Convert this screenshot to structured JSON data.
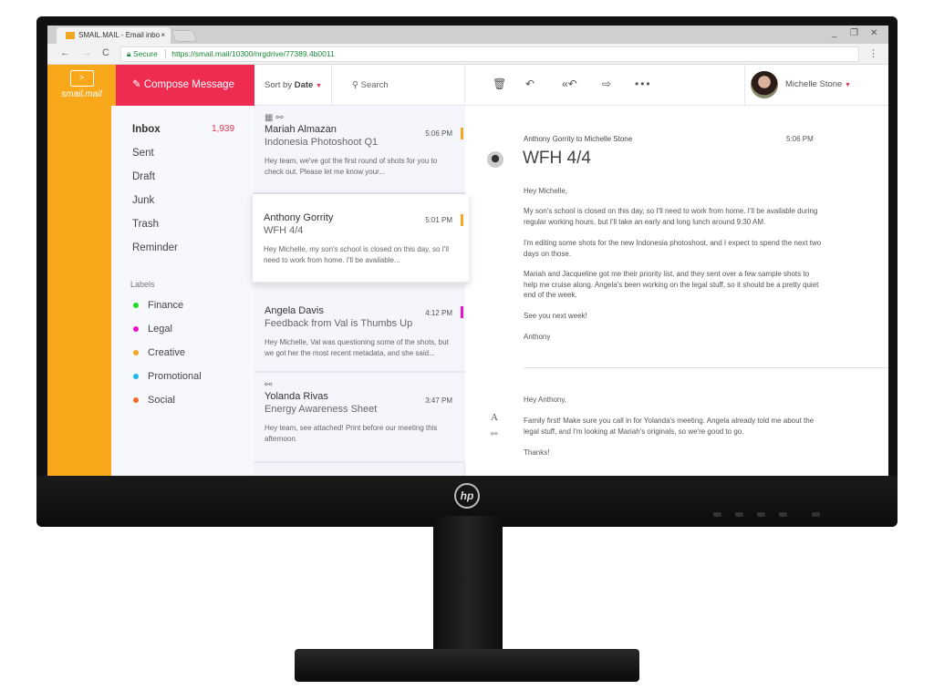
{
  "browser": {
    "tab_title": "SMAIL.MAIL - Email inbo",
    "tab_close": "×",
    "url_secure": "Secure",
    "url": "https://smail.mail/10300/nrgdrive/77389.4b0011",
    "back": "←",
    "forward": "→",
    "reload": "C",
    "menu": "⋮",
    "minimize": "_",
    "restore": "❐",
    "close": "✕"
  },
  "app": {
    "logo_text": "smail.mail",
    "logo_icon": "envelope-icon",
    "compose_label": "Compose Message",
    "compose_icon": "compose-icon",
    "brand_color": "#f9a81b",
    "accent_color": "#ee2c52"
  },
  "nav": {
    "folders": [
      {
        "label": "Inbox",
        "count": "1,939"
      },
      {
        "label": "Sent"
      },
      {
        "label": "Draft"
      },
      {
        "label": "Junk"
      },
      {
        "label": "Trash"
      },
      {
        "label": "Reminder"
      }
    ],
    "labels_heading": "Labels",
    "labels": [
      {
        "label": "Finance",
        "color": "#22dd22"
      },
      {
        "label": "Legal",
        "color": "#ee11cc"
      },
      {
        "label": "Creative",
        "color": "#f5a623"
      },
      {
        "label": "Promotional",
        "color": "#1cb8e8"
      },
      {
        "label": "Social",
        "color": "#f06a2a"
      }
    ]
  },
  "list_header": {
    "sort_prefix": "Sort by",
    "sort_value": "Date",
    "search_placeholder": "Search"
  },
  "mails": [
    {
      "icons": "calendar-icon link-icon",
      "from": "Mariah Almazan",
      "time": "5:06 PM",
      "subject": "Indonesia Photoshoot Q1",
      "preview": "Hey team, we've got the first round of shots for you to check out. Please let me know your...",
      "label_color": "#f5a623"
    },
    {
      "from": "Anthony Gorrity",
      "time": "5:01 PM",
      "subject": "WFH 4/4",
      "preview": "Hey Michelle, my son's school is closed on this day, so I'll need to work from home. I'll be available...",
      "label_color": "#f5a623",
      "selected": true
    },
    {
      "from": "Angela Davis",
      "time": "4:12 PM",
      "subject": "Feedback from Val is Thumbs Up",
      "preview": "Hey Michelle, Val was questioning some of the shots, but we got her the most recent metadata, and she said...",
      "label_color": "#ee11cc"
    },
    {
      "icons": "link-icon",
      "from": "Yolanda Rivas",
      "time": "3:47 PM",
      "subject": "Energy Awareness Sheet",
      "preview": "Hey team, see attached! Print before our meeting this afternoon."
    }
  ],
  "toolbar": {
    "icons": [
      "trash-icon",
      "reply-icon",
      "reply-all-icon",
      "forward-icon",
      "more-icon"
    ]
  },
  "user": {
    "name": "Michelle Stone"
  },
  "reading": {
    "meta": "Anthony Gorrity to Michelle Stone",
    "time": "5:06 PM",
    "subject": "WFH 4/4",
    "body": [
      "Hey Michelle,",
      "My son's school is closed on this day, so I'll need to work from home. I'll be available during regular working hours, but I'll take an early and long lunch around 9:30 AM.",
      "I'm editing some shots for the new Indonesia photoshoot, and I expect to spend the next two days on those.",
      "Mariah and Jacqueline got me their priority list, and they sent over a few sample shots to help me cruise along. Angela's been working on the legal stuff, so it should be a pretty quiet end of the week.",
      "See you next week!",
      "Anthony"
    ],
    "reply": [
      "Hey Anthony,",
      "Family first! Make sure you call in for Yolanda's meeting. Angela already told me about the legal stuff, and I'm looking at Mariah's originals, so we're good to go.",
      "Thanks!"
    ],
    "format_icon": "A"
  },
  "monitor": {
    "brand": "hp"
  }
}
